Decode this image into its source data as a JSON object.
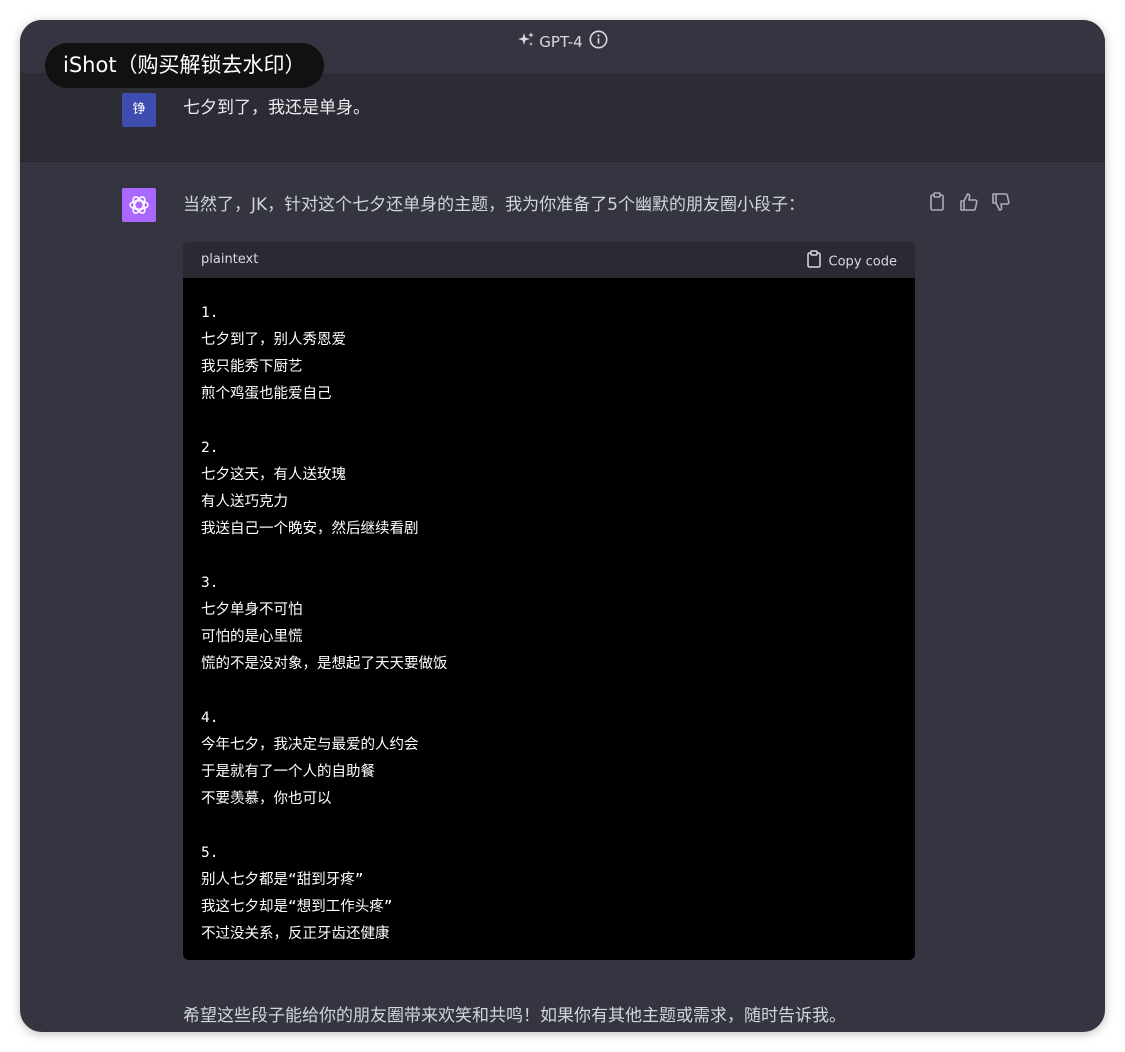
{
  "header": {
    "model_name": "GPT-4",
    "sparkle_icon": "sparkle-icon",
    "info_icon": "info-icon"
  },
  "watermark": {
    "text": "iShot（购买解锁去水印）"
  },
  "user_message": {
    "avatar_text": "铮",
    "text": "七夕到了，我还是单身。"
  },
  "assistant_message": {
    "avatar_icon": "openai-logo-icon",
    "intro": "当然了，JK，针对这个七夕还单身的主题，我为你准备了5个幽默的朋友圈小段子：",
    "actions": {
      "copy_icon": "clipboard-icon",
      "thumbs_up_icon": "thumbs-up-icon",
      "thumbs_down_icon": "thumbs-down-icon"
    },
    "code_block": {
      "language": "plaintext",
      "copy_label": "Copy code",
      "lines": [
        "1.",
        "七夕到了，别人秀恩爱",
        "我只能秀下厨艺",
        "煎个鸡蛋也能爱自己",
        "",
        "2.",
        "七夕这天，有人送玫瑰",
        "有人送巧克力",
        "我送自己一个晚安，然后继续看剧",
        "",
        "3.",
        "七夕单身不可怕",
        "可怕的是心里慌",
        "慌的不是没对象，是想起了天天要做饭",
        "",
        "4.",
        "今年七夕，我决定与最爱的人约会",
        "于是就有了一个人的自助餐",
        "不要羡慕，你也可以",
        "",
        "5.",
        "别人七夕都是“甜到牙疼”",
        "我这七夕却是“想到工作头疼”",
        "不过没关系，反正牙齿还健康"
      ]
    },
    "closing": "希望这些段子能给你的朋友圈带来欢笑和共鸣！如果你有其他主题或需求，随时告诉我。"
  },
  "colors": {
    "background": "#343541",
    "user_row": "#2b2c34",
    "user_avatar": "#3f4cb0",
    "assistant_avatar": "#ab68ff",
    "code_background": "#000000"
  }
}
